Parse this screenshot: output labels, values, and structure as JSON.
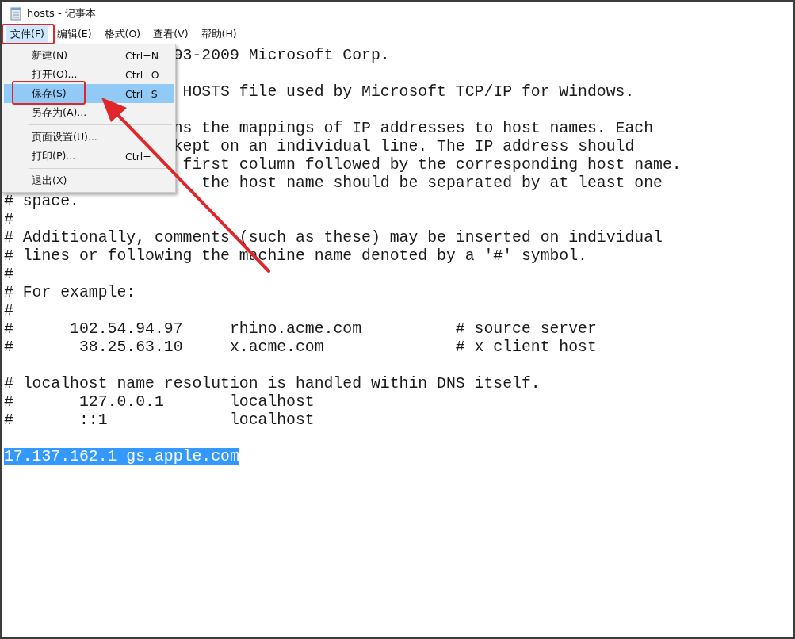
{
  "window": {
    "title": "hosts - 记事本"
  },
  "menu_bar": [
    {
      "label": "文件(F)",
      "selected": true,
      "outlined": true
    },
    {
      "label": "编辑(E)",
      "selected": false,
      "outlined": false
    },
    {
      "label": "格式(O)",
      "selected": false,
      "outlined": false
    },
    {
      "label": "查看(V)",
      "selected": false,
      "outlined": false
    },
    {
      "label": "帮助(H)",
      "selected": false,
      "outlined": false
    }
  ],
  "file_menu": [
    {
      "kind": "item",
      "label": "新建(N)",
      "shortcut": "Ctrl+N",
      "selected": false,
      "outlined": false
    },
    {
      "kind": "item",
      "label": "打开(O)...",
      "shortcut": "Ctrl+O",
      "selected": false,
      "outlined": false
    },
    {
      "kind": "item",
      "label": "保存(S)",
      "shortcut": "Ctrl+S",
      "selected": true,
      "outlined": true
    },
    {
      "kind": "item",
      "label": "另存为(A)...",
      "selected": false,
      "outlined": false
    },
    {
      "kind": "separator"
    },
    {
      "kind": "item",
      "label": "页面设置(U)...",
      "selected": false,
      "outlined": false
    },
    {
      "kind": "item",
      "label": "打印(P)...",
      "shortcut": "Ctrl+",
      "selected": false,
      "outlined": false
    },
    {
      "kind": "separator"
    },
    {
      "kind": "item",
      "label": "退出(X)",
      "selected": false,
      "outlined": false
    }
  ],
  "editor_lines": [
    {
      "kind": "text",
      "text": "                  93-2009 Microsoft Corp.",
      "selected": false
    },
    {
      "kind": "empty"
    },
    {
      "kind": "text",
      "text": "                   HOSTS file used by Microsoft TCP/IP for Windows.",
      "selected": false
    },
    {
      "kind": "empty"
    },
    {
      "kind": "text",
      "text": "                  ns the mappings of IP addresses to host names. Each",
      "selected": false
    },
    {
      "kind": "text",
      "text": "                  kept on an individual line. The IP address should",
      "selected": false
    },
    {
      "kind": "text",
      "text": "                   first column followed by the corresponding host name.",
      "selected": false
    },
    {
      "kind": "text",
      "text": "                     the host name should be separated by at least one",
      "selected": false
    },
    {
      "kind": "text",
      "text": "# space.",
      "selected": false
    },
    {
      "kind": "text",
      "text": "#",
      "selected": false
    },
    {
      "kind": "text",
      "text": "# Additionally, comments (such as these) may be inserted on individual",
      "selected": false
    },
    {
      "kind": "text",
      "text": "# lines or following the machine name denoted by a '#' symbol.",
      "selected": false
    },
    {
      "kind": "text",
      "text": "#",
      "selected": false
    },
    {
      "kind": "text",
      "text": "# For example:",
      "selected": false
    },
    {
      "kind": "text",
      "text": "#",
      "selected": false
    },
    {
      "kind": "text",
      "text": "#      102.54.94.97     rhino.acme.com          # source server",
      "selected": false
    },
    {
      "kind": "text",
      "text": "#       38.25.63.10     x.acme.com              # x client host",
      "selected": false
    },
    {
      "kind": "empty"
    },
    {
      "kind": "text",
      "text": "# localhost name resolution is handled within DNS itself.",
      "selected": false
    },
    {
      "kind": "text",
      "text": "#       127.0.0.1       localhost",
      "selected": false
    },
    {
      "kind": "text",
      "text": "#       ::1             localhost",
      "selected": false
    },
    {
      "kind": "empty"
    },
    {
      "kind": "text",
      "text": "17.137.162.1 gs.apple.com",
      "selected": true
    }
  ]
}
